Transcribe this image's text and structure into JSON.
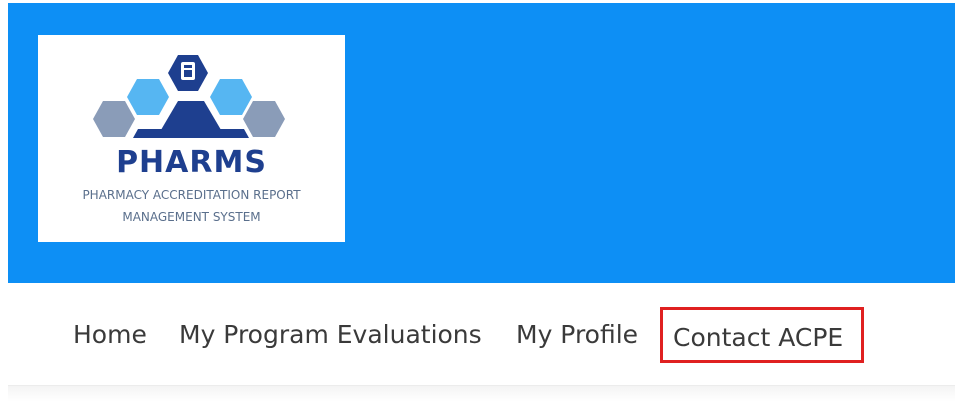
{
  "header": {
    "background_color": "#0d8ff5",
    "logo": {
      "title": "PHARMS",
      "subtitle_line1": "PHARMACY ACCREDITATION REPORT",
      "subtitle_line2": "MANAGEMENT SYSTEM",
      "colors": {
        "dark_blue": "#1e3f8f",
        "light_blue": "#56b6f2",
        "grey": "#8a9cb8"
      }
    }
  },
  "nav": {
    "items": [
      {
        "label": "Home"
      },
      {
        "label": "My Program Evaluations"
      },
      {
        "label": "My Profile"
      },
      {
        "label": "Contact ACPE",
        "highlighted": true,
        "highlight_color": "#e02020"
      }
    ]
  }
}
